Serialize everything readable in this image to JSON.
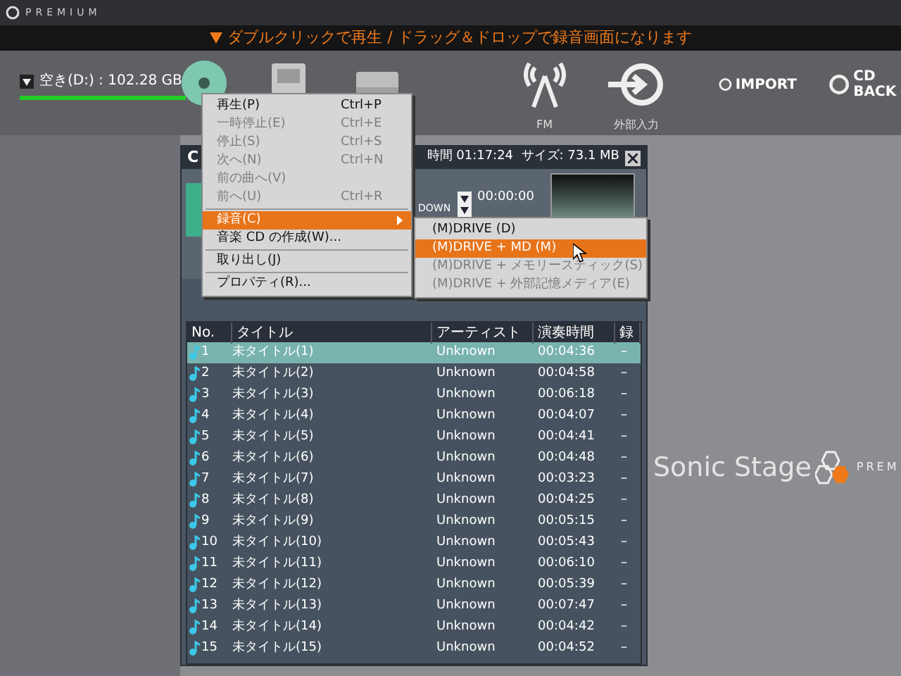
{
  "app": {
    "brand": "PREMIUM"
  },
  "notice": "ダブルクリックで再生 / ドラッグ＆ドロップで録音画面になります",
  "drive": {
    "label": "空き(D:) : 102.28 GB",
    "level": 1
  },
  "tools": [
    {
      "kind": "cd"
    },
    {
      "kind": "device"
    },
    {
      "kind": "card"
    },
    {
      "kind": "fm",
      "label": "FM"
    },
    {
      "kind": "line_in",
      "label": "外部入力"
    },
    {
      "kind": "import",
      "label": "IMPORT"
    },
    {
      "kind": "backup",
      "label": "CD BACK"
    }
  ],
  "logo": {
    "name": "Sonic Stage",
    "suffix": "PREM"
  },
  "panel": {
    "title": "C",
    "info": "時間 01:17:24  サイズ: 73.1 MB",
    "time": "00:00:00",
    "mode": "DOWN",
    "columns": [
      "No.",
      "タイトル",
      "アーティスト",
      "演奏時間",
      "録"
    ],
    "rows": [
      {
        "no": "1",
        "title": "未タイトル(1)",
        "artist": "Unknown",
        "time": "00:04:36",
        "rec": "–",
        "selected": true
      },
      {
        "no": "2",
        "title": "未タイトル(2)",
        "artist": "Unknown",
        "time": "00:04:58",
        "rec": "–",
        "selected": false
      },
      {
        "no": "3",
        "title": "未タイトル(3)",
        "artist": "Unknown",
        "time": "00:06:18",
        "rec": "–",
        "selected": false
      },
      {
        "no": "4",
        "title": "未タイトル(4)",
        "artist": "Unknown",
        "time": "00:04:07",
        "rec": "–",
        "selected": false
      },
      {
        "no": "5",
        "title": "未タイトル(5)",
        "artist": "Unknown",
        "time": "00:04:41",
        "rec": "–",
        "selected": false
      },
      {
        "no": "6",
        "title": "未タイトル(6)",
        "artist": "Unknown",
        "time": "00:04:48",
        "rec": "–",
        "selected": false
      },
      {
        "no": "7",
        "title": "未タイトル(7)",
        "artist": "Unknown",
        "time": "00:03:23",
        "rec": "–",
        "selected": false
      },
      {
        "no": "8",
        "title": "未タイトル(8)",
        "artist": "Unknown",
        "time": "00:04:25",
        "rec": "–",
        "selected": false
      },
      {
        "no": "9",
        "title": "未タイトル(9)",
        "artist": "Unknown",
        "time": "00:05:15",
        "rec": "–",
        "selected": false
      },
      {
        "no": "10",
        "title": "未タイトル(10)",
        "artist": "Unknown",
        "time": "00:05:43",
        "rec": "–",
        "selected": false
      },
      {
        "no": "11",
        "title": "未タイトル(11)",
        "artist": "Unknown",
        "time": "00:06:10",
        "rec": "–",
        "selected": false
      },
      {
        "no": "12",
        "title": "未タイトル(12)",
        "artist": "Unknown",
        "time": "00:05:39",
        "rec": "–",
        "selected": false
      },
      {
        "no": "13",
        "title": "未タイトル(13)",
        "artist": "Unknown",
        "time": "00:07:47",
        "rec": "–",
        "selected": false
      },
      {
        "no": "14",
        "title": "未タイトル(14)",
        "artist": "Unknown",
        "time": "00:04:42",
        "rec": "–",
        "selected": false
      },
      {
        "no": "15",
        "title": "未タイトル(15)",
        "artist": "Unknown",
        "time": "00:04:52",
        "rec": "–",
        "selected": false
      }
    ]
  },
  "menu": {
    "items": [
      {
        "kind": "item",
        "label": "再生(P)",
        "shortcut": "Ctrl+P",
        "disabled": false,
        "selected": false
      },
      {
        "kind": "item",
        "label": "一時停止(E)",
        "shortcut": "Ctrl+E",
        "disabled": true,
        "selected": false
      },
      {
        "kind": "item",
        "label": "停止(S)",
        "shortcut": "Ctrl+S",
        "disabled": true,
        "selected": false
      },
      {
        "kind": "item",
        "label": "次へ(N)",
        "shortcut": "Ctrl+N",
        "disabled": true,
        "selected": false
      },
      {
        "kind": "item",
        "label": "前の曲へ(V)",
        "disabled": true,
        "selected": false
      },
      {
        "kind": "item",
        "label": "前へ(U)",
        "shortcut": "Ctrl+R",
        "disabled": true,
        "selected": false
      },
      {
        "kind": "separator"
      },
      {
        "kind": "submenu",
        "label": "録音(C)",
        "disabled": false,
        "selected": true
      },
      {
        "kind": "item",
        "label": "音楽 CD の作成(W)...",
        "disabled": false,
        "selected": false
      },
      {
        "kind": "separator"
      },
      {
        "kind": "item",
        "label": "取り出し(J)",
        "disabled": false,
        "selected": false
      },
      {
        "kind": "separator"
      },
      {
        "kind": "item",
        "label": "プロパティ(R)...",
        "disabled": false,
        "selected": false
      }
    ],
    "submenu": [
      {
        "label": "(M)DRIVE (D)",
        "disabled": false,
        "selected": false
      },
      {
        "label": "(M)DRIVE + MD (M)",
        "disabled": false,
        "selected": true
      },
      {
        "label": "(M)DRIVE + メモリースティック(S)",
        "disabled": true,
        "selected": false
      },
      {
        "label": "(M)DRIVE + 外部記憶メディア(E)",
        "disabled": true,
        "selected": false
      }
    ]
  }
}
